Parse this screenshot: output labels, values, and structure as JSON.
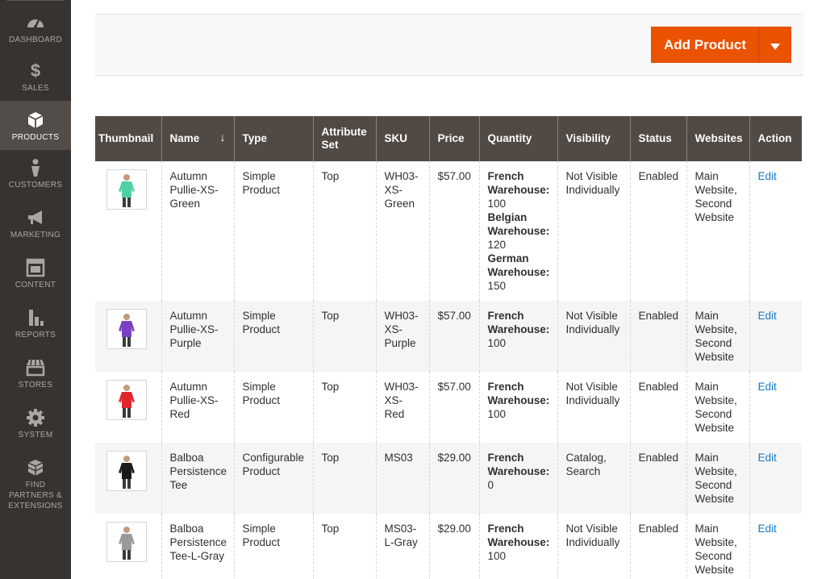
{
  "sidebar": {
    "items": [
      {
        "label": "DASHBOARD",
        "icon": "dashboard-icon"
      },
      {
        "label": "SALES",
        "icon": "dollar-icon"
      },
      {
        "label": "PRODUCTS",
        "icon": "cube-icon",
        "active": true
      },
      {
        "label": "CUSTOMERS",
        "icon": "person-icon"
      },
      {
        "label": "MARKETING",
        "icon": "megaphone-icon"
      },
      {
        "label": "CONTENT",
        "icon": "layout-icon"
      },
      {
        "label": "REPORTS",
        "icon": "bar-chart-icon"
      },
      {
        "label": "STORES",
        "icon": "storefront-icon"
      },
      {
        "label": "SYSTEM",
        "icon": "gear-icon"
      },
      {
        "label": "FIND PARTNERS & EXTENSIONS",
        "icon": "blocks-icon"
      }
    ]
  },
  "actions": {
    "add_product_label": "Add Product"
  },
  "grid": {
    "columns": [
      "Thumbnail",
      "Name",
      "Type",
      "Attribute Set",
      "SKU",
      "Price",
      "Quantity",
      "Visibility",
      "Status",
      "Websites",
      "Action"
    ],
    "sort_indicator": "↓",
    "rows": [
      {
        "shirt_color": "#4fd1a5",
        "name": "Autumn Pullie-XS-Green",
        "type": "Simple Product",
        "attribute_set": "Top",
        "sku": "WH03-XS-Green",
        "price": "$57.00",
        "quantity": [
          {
            "warehouse": "French Warehouse:",
            "qty": "100"
          },
          {
            "warehouse": "Belgian Warehouse:",
            "qty": "120"
          },
          {
            "warehouse": "German Warehouse:",
            "qty": "150"
          }
        ],
        "visibility": "Not Visible Individually",
        "status": "Enabled",
        "websites": "Main Website, Second Website",
        "action": "Edit"
      },
      {
        "shirt_color": "#7b3fc4",
        "name": "Autumn Pullie-XS-Purple",
        "type": "Simple Product",
        "attribute_set": "Top",
        "sku": "WH03-XS-Purple",
        "price": "$57.00",
        "quantity": [
          {
            "warehouse": "French Warehouse:",
            "qty": "100"
          }
        ],
        "visibility": "Not Visible Individually",
        "status": "Enabled",
        "websites": "Main Website, Second Website",
        "action": "Edit"
      },
      {
        "shirt_color": "#e0252c",
        "name": "Autumn Pullie-XS-Red",
        "type": "Simple Product",
        "attribute_set": "Top",
        "sku": "WH03-XS-Red",
        "price": "$57.00",
        "quantity": [
          {
            "warehouse": "French Warehouse:",
            "qty": "100"
          }
        ],
        "visibility": "Not Visible Individually",
        "status": "Enabled",
        "websites": "Main Website, Second Website",
        "action": "Edit"
      },
      {
        "shirt_color": "#1a1a1a",
        "name": "Balboa Persistence Tee",
        "type": "Configurable Product",
        "attribute_set": "Top",
        "sku": "MS03",
        "price": "$29.00",
        "quantity": [
          {
            "warehouse": "French Warehouse:",
            "qty": "0"
          }
        ],
        "visibility": "Catalog, Search",
        "status": "Enabled",
        "websites": "Main Website, Second Website",
        "action": "Edit"
      },
      {
        "shirt_color": "#9a9a9a",
        "name": "Balboa Persistence Tee-L-Gray",
        "type": "Simple Product",
        "attribute_set": "Top",
        "sku": "MS03-L-Gray",
        "price": "$29.00",
        "quantity": [
          {
            "warehouse": "French Warehouse:",
            "qty": "100"
          }
        ],
        "visibility": "Not Visible Individually",
        "status": "Enabled",
        "websites": "Main Website, Second Website",
        "action": "Edit"
      }
    ]
  },
  "colors": {
    "sidebar_bg": "#373330",
    "accent": "#eb5202",
    "header_bg": "#514943",
    "link": "#1979c3"
  }
}
